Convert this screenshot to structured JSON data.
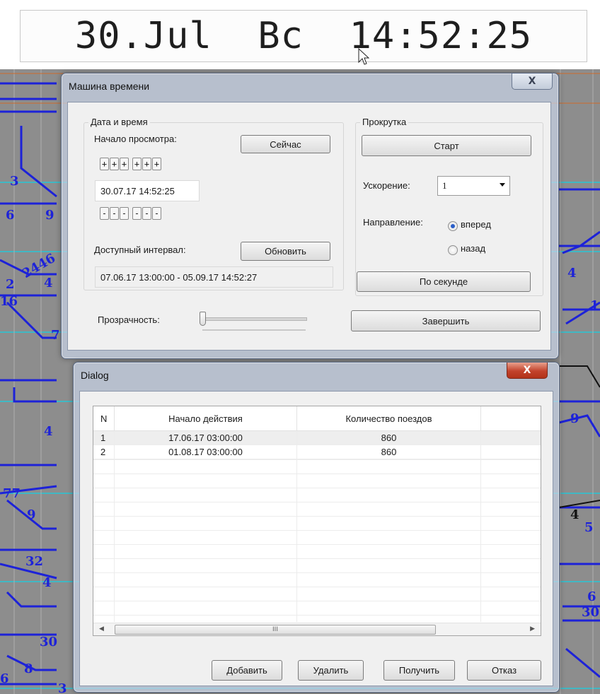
{
  "clock": {
    "text": "30.Jul  Bc  14:52:25"
  },
  "map_labels": [
    "3",
    "6",
    "9",
    "2446",
    "2",
    "4",
    "16",
    "7",
    "4",
    "77",
    "9",
    "32",
    "4",
    "30",
    "8",
    "6",
    "3",
    "4",
    "1",
    "9",
    "4",
    "5",
    "6",
    "30"
  ],
  "time_machine": {
    "title": "Машина времени",
    "close_label": "X",
    "date_group": {
      "title": "Дата и время",
      "start_label": "Начало просмотра:",
      "now_button": "Сейчас",
      "plus_buttons": [
        "+",
        "+",
        "+",
        "+",
        "+",
        "+"
      ],
      "datetime_value": "30.07.17 14:52:25",
      "minus_buttons": [
        "-",
        "-",
        "-",
        "-",
        "-",
        "-"
      ],
      "interval_label": "Доступный интервал:",
      "refresh_button": "Обновить",
      "interval_value": "07.06.17 13:00:00 - 05.09.17 14:52:27"
    },
    "scroll_group": {
      "title": "Прокрутка",
      "start_button": "Старт",
      "speed_label": "Ускорение:",
      "speed_value": "1",
      "direction_label": "Направление:",
      "forward_label": "вперед",
      "backward_label": "назад",
      "selected_direction": "вперед",
      "per_second_button": "По секунде"
    },
    "opacity_label": "Прозрачность:",
    "opacity_value": 0.0,
    "finish_button": "Завершить"
  },
  "dialog": {
    "title": "Dialog",
    "close_label": "X",
    "table": {
      "columns": [
        "N",
        "Начало действия",
        "Количество поездов"
      ],
      "rows": [
        [
          "1",
          "17.06.17 03:00:00",
          "860"
        ],
        [
          "2",
          "01.08.17 03:00:00",
          "860"
        ]
      ]
    },
    "scroll_thumb_label": "III",
    "buttons": {
      "add": "Добавить",
      "delete": "Удалить",
      "get": "Получить",
      "cancel": "Отказ"
    }
  }
}
